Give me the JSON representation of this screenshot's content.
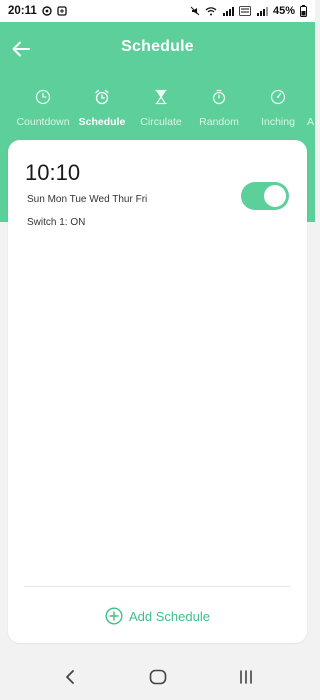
{
  "status_bar": {
    "time": "20:11",
    "battery": "45%"
  },
  "header": {
    "title": "Schedule",
    "background": "#5ccf9b"
  },
  "tabs": [
    {
      "label": "Countdown",
      "icon": "clock-icon",
      "active": false
    },
    {
      "label": "Schedule",
      "icon": "alarm-icon",
      "active": true
    },
    {
      "label": "Circulate",
      "icon": "hourglass-icon",
      "active": false
    },
    {
      "label": "Random",
      "icon": "stopwatch-icon",
      "active": false
    },
    {
      "label": "Inching",
      "icon": "timer-icon",
      "active": false
    },
    {
      "label": "A",
      "icon": "",
      "active": false
    }
  ],
  "schedule": {
    "time": "10:10",
    "days": "Sun Mon Tue Wed Thur Fri",
    "switch": "Switch 1: ON",
    "enabled": true
  },
  "add_schedule": {
    "label": "Add Schedule",
    "color": "#3fbf88"
  },
  "nav_bar": {
    "back": "back-icon",
    "home": "home-icon",
    "recents": "recents-icon"
  }
}
